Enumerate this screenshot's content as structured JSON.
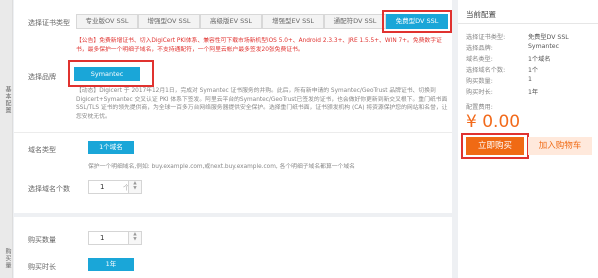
{
  "sidebar": {
    "section1": "基本配置",
    "section2": "购买量"
  },
  "cert_type": {
    "label": "选择证书类型",
    "tabs": [
      "专业版OV SSL",
      "增强型OV SSL",
      "高级版EV SSL",
      "增强型EV SSL",
      "通配符DV SSL",
      "免费型DV SSL"
    ],
    "active_index": 5
  },
  "notice_red": "【公告】免费新增证书、切入DigiCert PKI体系、兼容性可下载市场新机型iOS 5.0+、Android 2.3.3+、JRE 1.5.5+、WIN 7+。免费数字证书，最多保护一个明细子域名，不支持通配符，一个阿里云帐户最多签发20张免费证书。",
  "brand": {
    "label": "选择品牌",
    "button": "Symantec"
  },
  "notice_gray": "【动态】Digicert 于 2017年12月1日，完成对 Symantec 证书服务的并购。此后，所有新申请的 Symantec/GeoTrust 品牌证书、切换到 Digicert+Symantec 交叉认证 PKI 体系下签发。阿里云平台的Symantec/GeoTrust已签发的证书，也会做好你更新到新交叉根下。重门纸书面 SSL/TLS 证书的领先提供商，为全球一百多万台网络服务器提供安全保护。选择重门纸书面，证书颁发机构 (CA) 将资源保护您的网站和名誉，让您安枕无忧。",
  "domain_type": {
    "label": "域名类型",
    "button": "1个域名",
    "hint": "保护一个明细域名,例如: buy.example.com,或next.buy.example.com, 各个明细子域名都算一个域名"
  },
  "domain_count": {
    "label": "选择域名个数",
    "value": "1",
    "unit": "个"
  },
  "purchase": {
    "qty_label": "购买数量",
    "qty_value": "1",
    "duration_label": "购买时长",
    "duration_button": "1年"
  },
  "summary": {
    "title": "当前配置",
    "rows": [
      {
        "k": "选择证书类型:",
        "v": "免费型DV SSL"
      },
      {
        "k": "选择品牌:",
        "v": "Symantec"
      },
      {
        "k": "域名类型:",
        "v": "1个域名"
      },
      {
        "k": "选择域名个数:",
        "v": "1个"
      },
      {
        "k": "购买数量:",
        "v": "1"
      },
      {
        "k": "购买时长:",
        "v": "1年"
      }
    ],
    "fee_label": "配置费用:",
    "price": "¥ 0.00",
    "buy_button": "立即购买",
    "cart_button": "加入购物车"
  }
}
